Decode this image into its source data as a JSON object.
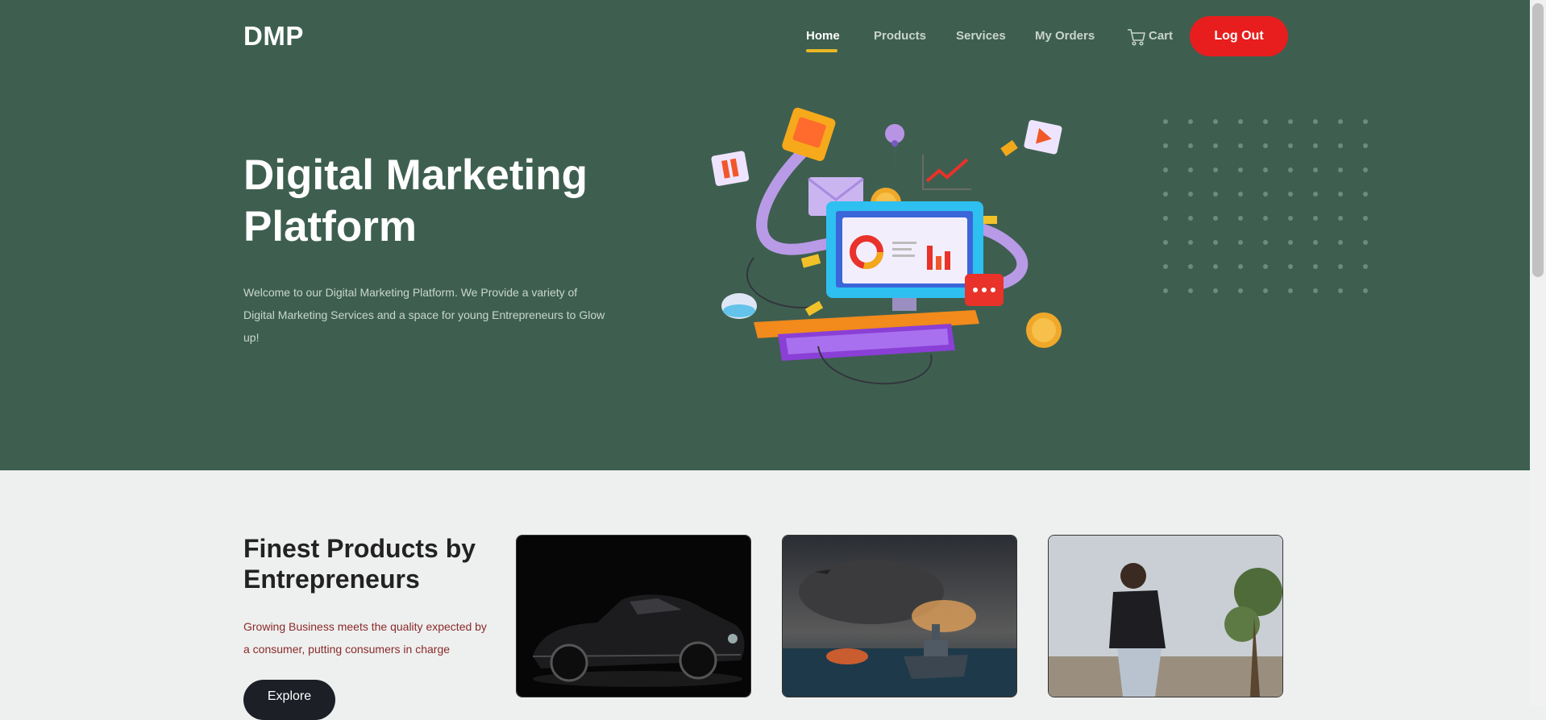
{
  "brand": "DMP",
  "nav": {
    "home": "Home",
    "products": "Products",
    "services": "Services",
    "orders": "My Orders",
    "cart": "Cart",
    "logout": "Log Out"
  },
  "hero": {
    "title_line1": "Digital Marketing",
    "title_line2": "Platform",
    "description": "Welcome to our Digital Marketing Platform. We Provide a variety of Digital Marketing Services and a space for young Entrepreneurs to Glow up!"
  },
  "products": {
    "title_line1": "Finest Products by",
    "title_line2": "Entrepreneurs",
    "description": "Growing Business meets the quality expected by a consumer, putting consumers in charge",
    "explore": "Explore"
  },
  "colors": {
    "hero_bg": "#3e5f50",
    "accent": "#e8b825",
    "logout": "#e81d1d"
  }
}
